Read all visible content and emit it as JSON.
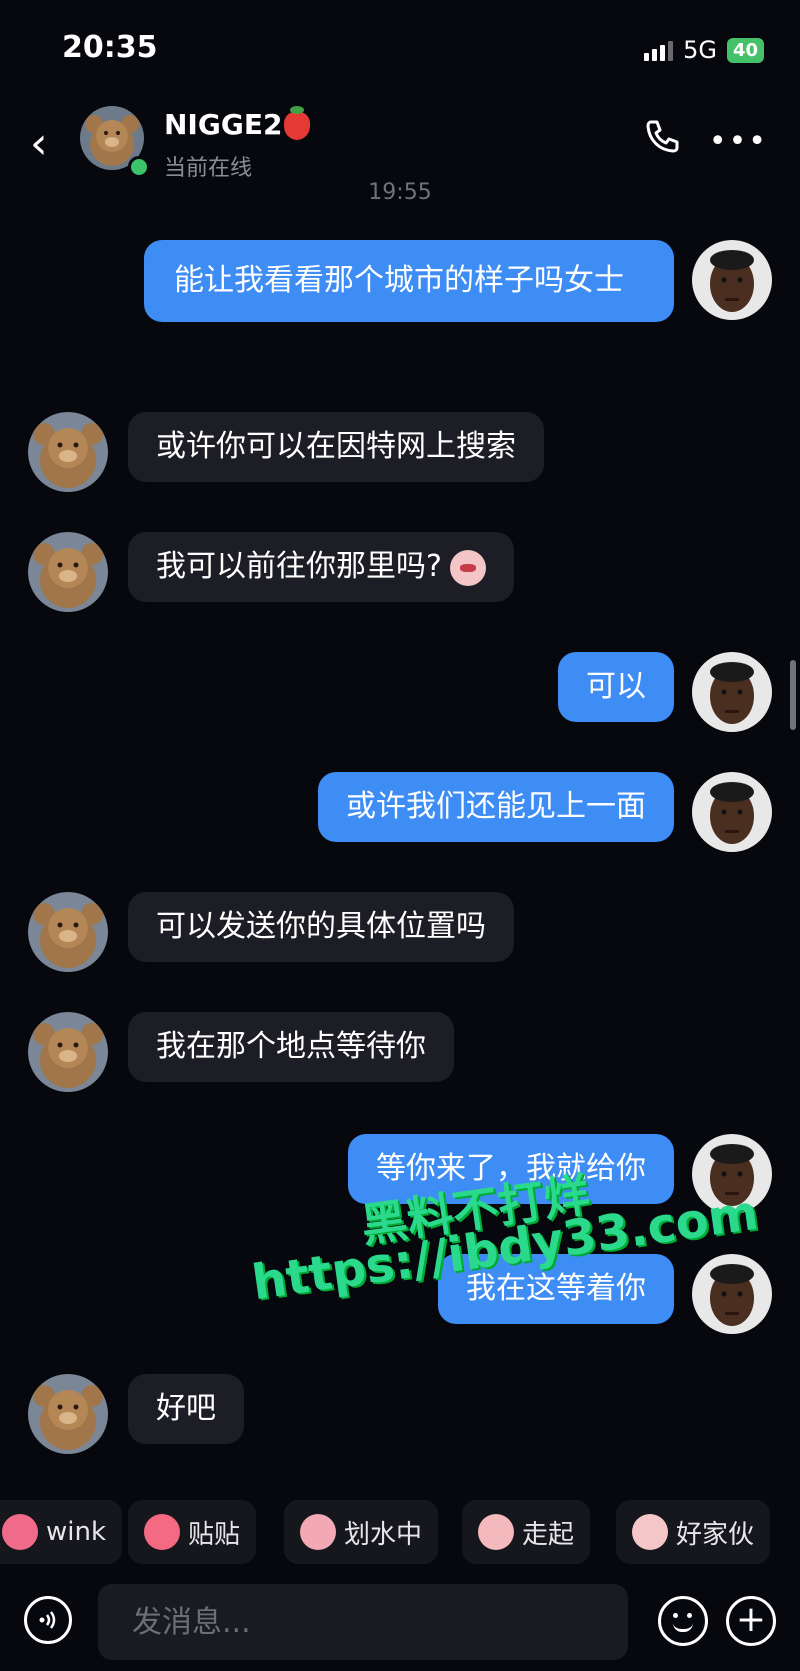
{
  "status_bar": {
    "time": "20:35",
    "network": "5G",
    "battery": "40"
  },
  "header": {
    "contact_name": "NIGGE2",
    "presence": "当前在线"
  },
  "time_divider": "19:55",
  "messages": [
    {
      "from": "me",
      "text": "能让我看看那个城市的样子吗女士"
    },
    {
      "from": "them",
      "text": "或许你可以在因特网上搜索"
    },
    {
      "from": "them",
      "text": "我可以前往你那里吗?"
    },
    {
      "from": "me",
      "text": "可以"
    },
    {
      "from": "me",
      "text": "或许我们还能见上一面"
    },
    {
      "from": "them",
      "text": "可以发送你的具体位置吗"
    },
    {
      "from": "them",
      "text": "我在那个地点等待你"
    },
    {
      "from": "me",
      "text": "等你来了，我就给你"
    },
    {
      "from": "me",
      "text": "我在这等着你"
    },
    {
      "from": "them",
      "text": "好吧"
    }
  ],
  "watermark": {
    "line1": "黑料不打烊",
    "line2": "https://ibdy33.com"
  },
  "quick_replies": [
    "wink",
    "贴贴",
    "划水中",
    "走起",
    "好家伙"
  ],
  "input": {
    "placeholder": "发消息..."
  },
  "colors": {
    "background": "#07080d",
    "outgoing_bubble": "#3d8df5",
    "incoming_bubble": "#1d1e25",
    "online": "#3cc36b"
  }
}
